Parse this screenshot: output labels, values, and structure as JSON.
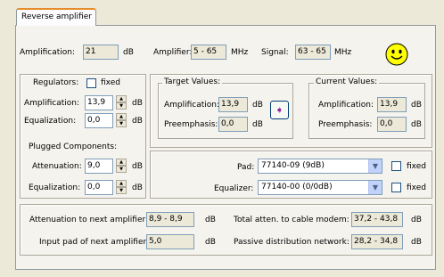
{
  "tab": {
    "label": "Reverse amplifier"
  },
  "top": {
    "amplification_label": "Amplification:",
    "amplification_value": "21",
    "amplification_unit": "dB",
    "amplifier_label": "Amplifier:",
    "amplifier_value": "5 - 65",
    "amplifier_unit": "MHz",
    "signal_label": "Signal:",
    "signal_value": "63 - 65",
    "signal_unit": "MHz"
  },
  "regulators": {
    "title": "Regulators:",
    "fixed_label": "fixed",
    "amplification_label": "Amplification:",
    "amplification_value": "13,9",
    "equalization_label": "Equalization:",
    "equalization_value": "0,0",
    "unit": "dB"
  },
  "plugged": {
    "title": "Plugged Components:",
    "attenuation_label": "Attenuation:",
    "attenuation_value": "9,0",
    "equalization_label": "Equalization:",
    "equalization_value": "0,0",
    "unit": "dB"
  },
  "target": {
    "title": "Target Values:",
    "amplification_label": "Amplification:",
    "amplification_value": "13,9",
    "preemphasis_label": "Preemphasis:",
    "preemphasis_value": "0,0",
    "unit": "dB",
    "apply_glyph": "➧"
  },
  "current": {
    "title": "Current Values:",
    "amplification_label": "Amplification:",
    "amplification_value": "13,9",
    "preemphasis_label": "Preemphasis:",
    "preemphasis_value": "0,0",
    "unit": "dB"
  },
  "components": {
    "pad_label": "Pad:",
    "pad_value": "77140-09 (9dB)",
    "pad_fixed_label": "fixed",
    "equalizer_label": "Equalizer:",
    "equalizer_value": "77140-00 (0/0dB)",
    "equalizer_fixed_label": "fixed"
  },
  "bottom": {
    "att_next_label": "Attenuation to next amplifier:",
    "att_next_value": "8,9 - 8,9",
    "input_pad_label": "Input pad of next amplifier:",
    "input_pad_value": "5,0",
    "total_atten_label": "Total atten. to cable modem:",
    "total_atten_value": "37,2 - 43,8",
    "passive_label": "Passive distribution network:",
    "passive_value": "28,2 - 34,8",
    "unit": "dB"
  },
  "status_icon": "smiley-face-icon",
  "colors": {
    "smiley": "#ffff00",
    "arrow": "#8e1d9c"
  }
}
